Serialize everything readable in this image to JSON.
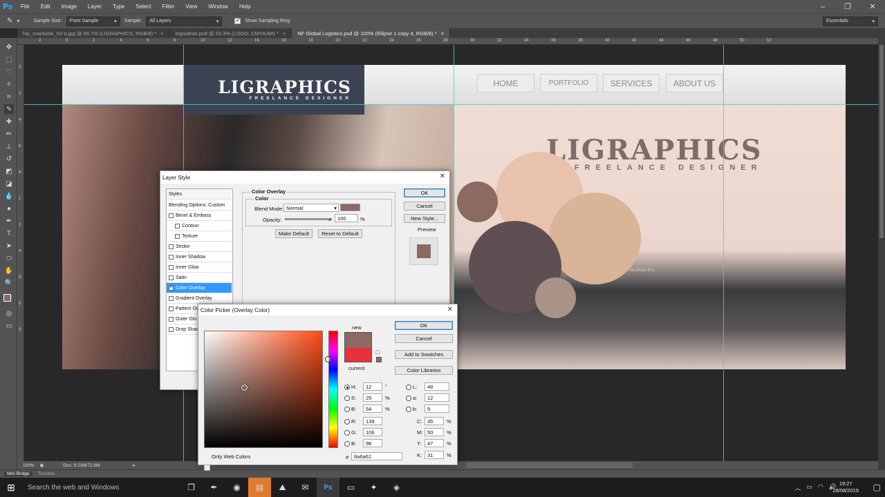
{
  "app": {
    "logo": "Ps"
  },
  "menu": [
    "File",
    "Edit",
    "Image",
    "Layer",
    "Type",
    "Select",
    "Filter",
    "View",
    "Window",
    "Help"
  ],
  "options": {
    "sample_size_label": "Sample Size:",
    "sample_size_value": "Point Sample",
    "sample_label": "Sample:",
    "sample_value": "All Layers",
    "sampling_ring_label": "Show Sampling Ring",
    "workspace": "Essentials"
  },
  "tabs": [
    {
      "label": "hip_macbook_02-o.jpg @ 66.7% (LIGRAPHICS, RGB/8) *"
    },
    {
      "label": "logoideas.psd @ 33.3% (LOGO, CMYK/8#) *"
    },
    {
      "label": "NF Global Logistics.psd @ 100% (Ellipse 1 copy 4, RGB/8) *"
    }
  ],
  "ruler_top": [
    "2",
    "0",
    "2",
    "4",
    "6",
    "8",
    "10",
    "12",
    "14",
    "16",
    "18",
    "20",
    "22",
    "24",
    "26",
    "28",
    "30",
    "32",
    "34",
    "36",
    "38",
    "40",
    "42",
    "44",
    "46",
    "48",
    "50",
    "52"
  ],
  "ruler_left": [
    "0",
    "2",
    "4",
    "6",
    "8",
    "1",
    "2",
    "4",
    "6",
    "8",
    "3"
  ],
  "canvas": {
    "logo_title": "LIGRAPHICS",
    "logo_sub": "FREELANCE DESIGNER",
    "nav": [
      "HOME",
      "PORTFOLIO",
      "SERVICES",
      "ABOUT US"
    ],
    "big_logo_title": "LIGRAPHICS",
    "big_logo_sub": "FREELANCE DESIGNER",
    "laptop_label": "MacBook Pro",
    "circle_colors": [
      "#e9c2ad",
      "#8b6a62",
      "#d9b497",
      "#5e5052",
      "#a89386"
    ]
  },
  "layer_style": {
    "title": "Layer Style",
    "styles_header": "Styles",
    "blending": "Blending Options: Custom",
    "items": [
      {
        "label": "Bevel & Emboss",
        "checked": false
      },
      {
        "label": "Contour",
        "checked": false
      },
      {
        "label": "Texture",
        "checked": false
      },
      {
        "label": "Stroke",
        "checked": false
      },
      {
        "label": "Inner Shadow",
        "checked": false
      },
      {
        "label": "Inner Glow",
        "checked": false
      },
      {
        "label": "Satin",
        "checked": false
      },
      {
        "label": "Color Overlay",
        "checked": true
      },
      {
        "label": "Gradient Overlay",
        "checked": false
      },
      {
        "label": "Pattern Ov",
        "checked": false
      },
      {
        "label": "Outer Glo",
        "checked": false
      },
      {
        "label": "Drop Shad",
        "checked": false
      }
    ],
    "group_title": "Color Overlay",
    "sub_title": "Color",
    "blend_mode_label": "Blend Mode:",
    "blend_mode_value": "Normal",
    "opacity_label": "Opacity:",
    "opacity_value": "100",
    "opacity_unit": "%",
    "make_default": "Make Default",
    "reset_default": "Reset to Default",
    "ok": "OK",
    "cancel": "Cancel",
    "new_style": "New Style...",
    "preview": "Preview",
    "overlay_color": "#8a6a62"
  },
  "color_picker": {
    "title": "Color Picker (Overlay Color)",
    "new_label": "new",
    "current_label": "current",
    "new_color": "#8a6a62",
    "current_color": "#e8313a",
    "ok": "OK",
    "cancel": "Cancel",
    "add_swatches": "Add to Swatches",
    "color_libraries": "Color Libraries",
    "H": "12",
    "H_unit": "°",
    "S": "29",
    "S_unit": "%",
    "Bv": "54",
    "B_unit": "%",
    "R": "138",
    "G": "106",
    "Bb": "98",
    "L": "48",
    "a": "12",
    "b": "9",
    "C": "35",
    "M": "50",
    "Y": "47",
    "K": "31",
    "hex": "8a6a62",
    "only_web": "Only Web Colors",
    "lbl_H": "H:",
    "lbl_S": "S:",
    "lbl_B": "B:",
    "lbl_R": "R:",
    "lbl_G": "G:",
    "lbl_B2": "B:",
    "lbl_L": "L:",
    "lbl_a": "a:",
    "lbl_b": "b:",
    "lbl_C": "C:",
    "lbl_M": "M:",
    "lbl_Y": "Y:",
    "lbl_K": "K:",
    "lbl_hash": "#",
    "pct": "%"
  },
  "status": {
    "zoom": "100%",
    "doc": "Doc: 9.23M/72.6M"
  },
  "minibridge": [
    "Mini Bridge",
    "Timeline"
  ],
  "taskbar": {
    "search": "Search the web and Windows",
    "time": "19:27",
    "date": "28/08/2015"
  }
}
